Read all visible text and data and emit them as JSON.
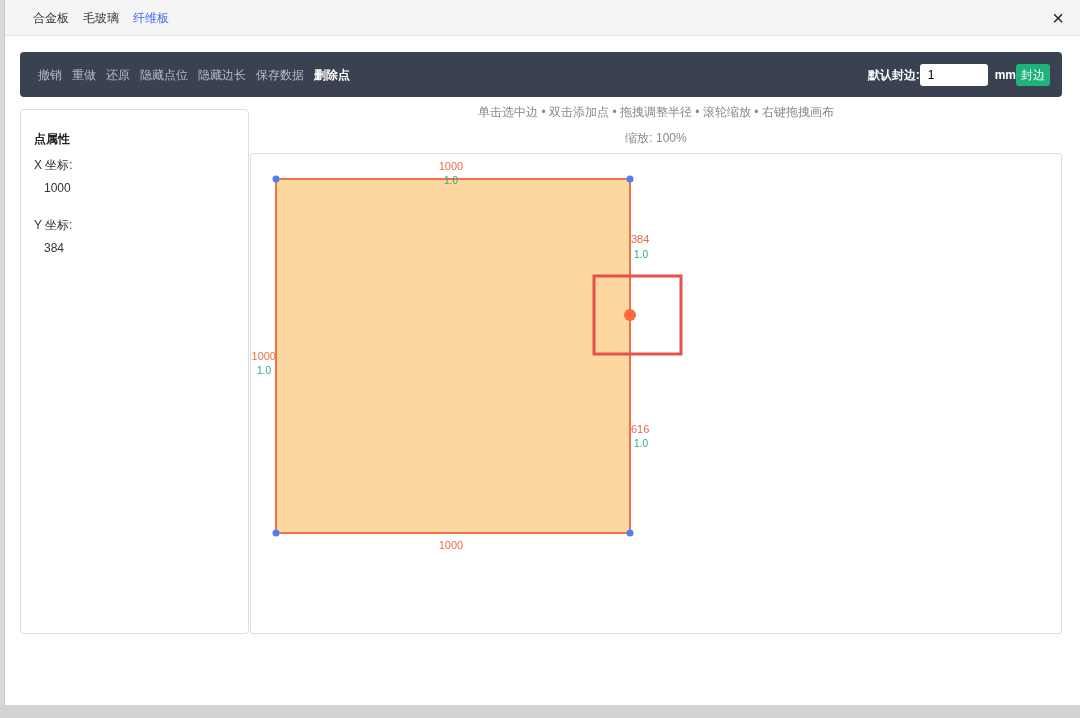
{
  "tabs": [
    {
      "label": "合金板",
      "selected": false
    },
    {
      "label": "毛玻璃",
      "selected": false
    },
    {
      "label": "纤维板",
      "selected": true
    }
  ],
  "close": "×",
  "toolbar": {
    "actions": [
      {
        "label": "撤销",
        "highlighted": false
      },
      {
        "label": "重做",
        "highlighted": false
      },
      {
        "label": "还原",
        "highlighted": false
      },
      {
        "label": "隐藏点位",
        "highlighted": false
      },
      {
        "label": "隐藏边长",
        "highlighted": false
      },
      {
        "label": "保存数据",
        "highlighted": false
      },
      {
        "label": "删除点",
        "highlighted": true
      }
    ],
    "edge_label": "默认封边:",
    "edge_value": "1",
    "edge_unit": "mm",
    "edge_button": "封边"
  },
  "properties": {
    "title": "点属性",
    "fields": [
      {
        "label": "X 坐标:",
        "value": "1000"
      },
      {
        "label": "Y 坐标:",
        "value": "384"
      }
    ]
  },
  "hint": "单击选中边 • 双击添加点 • 拖拽调整半径 • 滚轮缩放 • 右键拖拽画布",
  "zoom": "缩放: 100%",
  "canvas": {
    "edges": [
      {
        "length": "1000",
        "factor": "1.0"
      },
      {
        "length": "384",
        "factor": "1.0"
      },
      {
        "length": "616",
        "factor": "1.0"
      },
      {
        "length": "1000"
      },
      {
        "length": "1000",
        "factor": "1.0"
      }
    ],
    "points": [
      {
        "selected": false
      },
      {
        "selected": false
      },
      {
        "selected": true
      },
      {
        "selected": false
      },
      {
        "selected": false
      }
    ],
    "highlight_box": true
  }
}
